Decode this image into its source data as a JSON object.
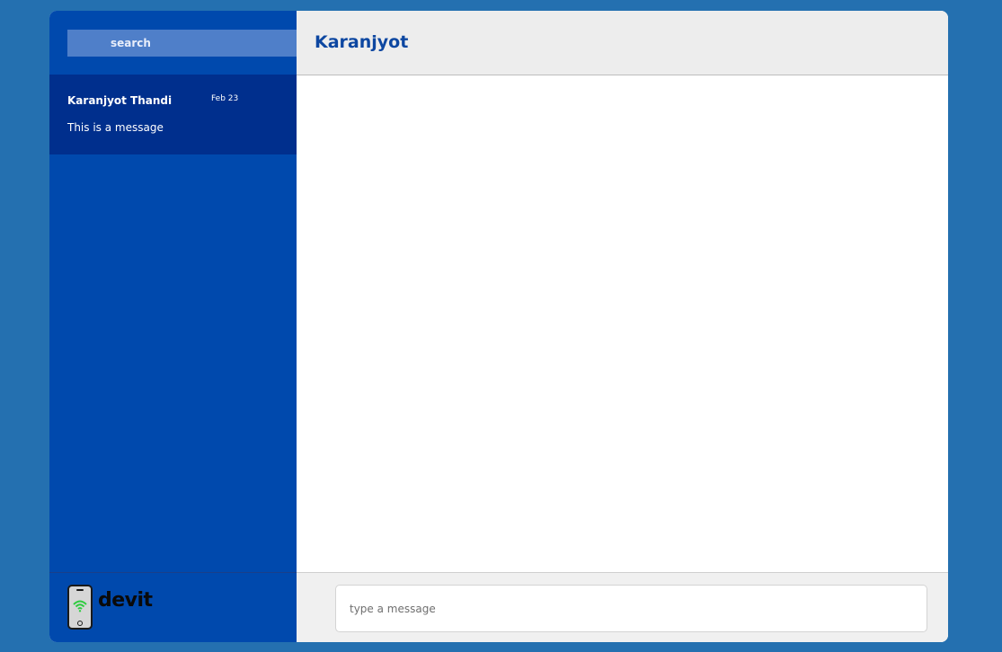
{
  "colors": {
    "page_background": "#2470b0",
    "sidebar_background": "#0049ad",
    "selected_conversation": "#002f8d",
    "search_background": "#4f7fc9",
    "header_background": "#ededed",
    "chat_title": "#0d47a1",
    "composer_background": "#f0f0f0"
  },
  "search": {
    "placeholder": "search"
  },
  "conversations": [
    {
      "name": "Karanjyot Thandi",
      "date": "Feb 23",
      "preview": "This is a message",
      "selected": true
    }
  ],
  "chat": {
    "title": "Karanjyot"
  },
  "composer": {
    "placeholder": "type a message",
    "value": ""
  },
  "brand": {
    "name": "devit",
    "logo_icon": "phone-wifi-icon"
  }
}
